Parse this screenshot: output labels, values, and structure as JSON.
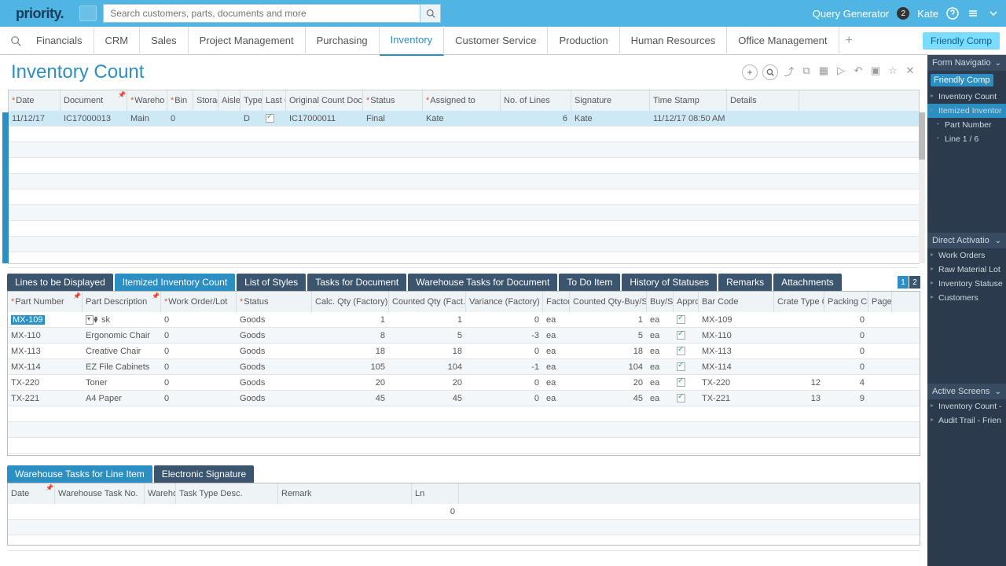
{
  "topbar": {
    "logo": "priority",
    "search_placeholder": "Search customers, parts, documents and more",
    "query_generator": "Query Generator",
    "badge": "2",
    "user": "Kate"
  },
  "nav": {
    "items": [
      "Financials",
      "CRM",
      "Sales",
      "Project Management",
      "Purchasing",
      "Inventory",
      "Customer Service",
      "Production",
      "Human Resources",
      "Office Management"
    ],
    "active": 5,
    "friendly": "Friendly Comp"
  },
  "page": {
    "title": "Inventory Count"
  },
  "upper": {
    "cols": [
      {
        "label": "Date",
        "w": 66,
        "req": true
      },
      {
        "label": "Document",
        "w": 85,
        "pin": true
      },
      {
        "label": "Wareho",
        "w": 51,
        "req": true
      },
      {
        "label": "Bin",
        "w": 33,
        "req": true
      },
      {
        "label": "Storag",
        "w": 32
      },
      {
        "label": "Aisle",
        "w": 28
      },
      {
        "label": "Type",
        "w": 28
      },
      {
        "label": "Last C",
        "w": 30
      },
      {
        "label": "Original Count Doc",
        "w": 98
      },
      {
        "label": "Status",
        "w": 76,
        "req": true
      },
      {
        "label": "Assigned to",
        "w": 99,
        "req": true
      },
      {
        "label": "No. of Lines",
        "w": 90
      },
      {
        "label": "Signature",
        "w": 100
      },
      {
        "label": "Time Stamp",
        "w": 98
      },
      {
        "label": "Details",
        "w": 92
      }
    ],
    "row": {
      "date": "11/12/17",
      "doc": "IC17000013",
      "wh": "Main",
      "bin": "0",
      "type": "D",
      "orig": "IC17000011",
      "status": "Final",
      "assigned": "Kate",
      "lines": "6",
      "sig": "Kate",
      "ts": "11/12/17 08:50 AM"
    }
  },
  "tabs_mid": [
    "Lines to be Displayed",
    "Itemized Inventory Count",
    "List of Styles",
    "Tasks for Document",
    "Warehouse Tasks for Document",
    "To Do Item",
    "History of Statuses",
    "Remarks",
    "Attachments"
  ],
  "mid_active": 1,
  "mid": {
    "cols": [
      {
        "label": "Part Number",
        "w": 95,
        "req": true,
        "pin": true
      },
      {
        "label": "Part Description",
        "w": 100,
        "pin": true
      },
      {
        "label": "Work Order/Lot",
        "w": 96,
        "req": true
      },
      {
        "label": "Status",
        "w": 96,
        "req": true
      },
      {
        "label": "Calc. Qty (Factory)",
        "w": 98
      },
      {
        "label": "Counted Qty (Fact.",
        "w": 98
      },
      {
        "label": "Variance (Factory)",
        "w": 98
      },
      {
        "label": "Factory",
        "w": 34
      },
      {
        "label": "Counted Qty-Buy/S",
        "w": 98
      },
      {
        "label": "Buy/Se",
        "w": 34
      },
      {
        "label": "Appro",
        "w": 32
      },
      {
        "label": "Bar Code",
        "w": 96
      },
      {
        "label": "Crate Type C",
        "w": 64
      },
      {
        "label": "Packing Cr",
        "w": 56
      },
      {
        "label": "Page",
        "w": 30
      }
    ],
    "rows": [
      {
        "pn": "MX-109",
        "desc": "sk",
        "wol": "0",
        "st": "Goods",
        "cq": "1",
        "cnt": "1",
        "var": "0",
        "fu": "ea",
        "cbq": "1",
        "bu": "ea",
        "ap": true,
        "bc": "MX-109",
        "ct": "",
        "pc": "0"
      },
      {
        "pn": "MX-110",
        "desc": "Ergonomic Chair",
        "wol": "0",
        "st": "Goods",
        "cq": "8",
        "cnt": "5",
        "var": "-3",
        "fu": "ea",
        "cbq": "5",
        "bu": "ea",
        "ap": true,
        "bc": "MX-110",
        "ct": "",
        "pc": "0"
      },
      {
        "pn": "MX-113",
        "desc": "Creative Chair",
        "wol": "0",
        "st": "Goods",
        "cq": "18",
        "cnt": "18",
        "var": "0",
        "fu": "ea",
        "cbq": "18",
        "bu": "ea",
        "ap": true,
        "bc": "MX-113",
        "ct": "",
        "pc": "0"
      },
      {
        "pn": "MX-114",
        "desc": "EZ File Cabinets",
        "wol": "0",
        "st": "Goods",
        "cq": "105",
        "cnt": "104",
        "var": "-1",
        "fu": "ea",
        "cbq": "104",
        "bu": "ea",
        "ap": true,
        "bc": "MX-114",
        "ct": "",
        "pc": "0"
      },
      {
        "pn": "TX-220",
        "desc": "Toner",
        "wol": "0",
        "st": "Goods",
        "cq": "20",
        "cnt": "20",
        "var": "0",
        "fu": "ea",
        "cbq": "20",
        "bu": "ea",
        "ap": true,
        "bc": "TX-220",
        "ct": "12",
        "pc": "4"
      },
      {
        "pn": "TX-221",
        "desc": "A4 Paper",
        "wol": "0",
        "st": "Goods",
        "cq": "45",
        "cnt": "45",
        "var": "0",
        "fu": "ea",
        "cbq": "45",
        "bu": "ea",
        "ap": true,
        "bc": "TX-221",
        "ct": "13",
        "pc": "9"
      }
    ]
  },
  "tabs_low": [
    "Warehouse Tasks for Line Item",
    "Electronic Signature"
  ],
  "low_active": 0,
  "low": {
    "cols": [
      {
        "label": "Date",
        "w": 60,
        "pin": true
      },
      {
        "label": "Warehouse Task No.",
        "w": 114
      },
      {
        "label": "Wareho",
        "w": 40
      },
      {
        "label": "Task Type Desc.",
        "w": 130
      },
      {
        "label": "Remark",
        "w": 170
      },
      {
        "label": "Ln",
        "w": 60
      }
    ],
    "row": {
      "ln": "0"
    }
  },
  "sidebar": {
    "nav_title": "Form Navigatio",
    "friendly": "Friendly Comp",
    "tree": [
      "Inventory Count",
      "Itemized Inventor"
    ],
    "tree_sub": [
      "Part Number",
      "Line 1 / 6"
    ],
    "da_title": "Direct Activatio",
    "da": [
      "Work Orders",
      "Raw Material Lot",
      "Inventory Statuse",
      "Customers"
    ],
    "as_title": "Active Screens",
    "as": [
      "Inventory Count -",
      "Audit Trail - Frien"
    ]
  }
}
